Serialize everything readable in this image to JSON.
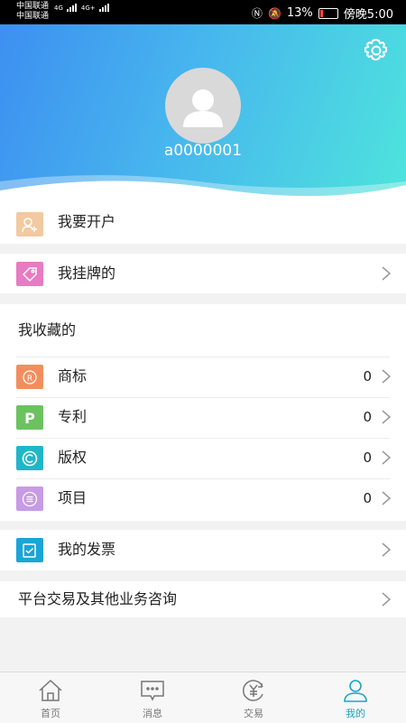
{
  "status_bar": {
    "carrier1": "中国联通",
    "carrier2": "中国联通",
    "net1": "4G",
    "net2": "4G+",
    "battery": "13%",
    "time": "傍晚5:00"
  },
  "profile": {
    "username": "a0000001",
    "settings_icon": "gear-icon",
    "avatar_icon": "person-icon"
  },
  "menu": {
    "open_account": "我要开户",
    "my_listings": "我挂牌的",
    "favorites_title": "我收藏的",
    "favorites": [
      {
        "label": "商标",
        "count": "0",
        "icon": "trademark-icon",
        "color": "#f28e5e"
      },
      {
        "label": "专利",
        "count": "0",
        "icon": "patent-icon",
        "color": "#6cc25f"
      },
      {
        "label": "版权",
        "count": "0",
        "icon": "copyright-icon",
        "color": "#1fb7c7"
      },
      {
        "label": "项目",
        "count": "0",
        "icon": "project-icon",
        "color": "#c79be5"
      }
    ],
    "invoice": "我的发票",
    "consult": "平台交易及其他业务咨询"
  },
  "tabs": [
    {
      "label": "首页",
      "icon": "home-icon"
    },
    {
      "label": "消息",
      "icon": "message-icon"
    },
    {
      "label": "交易",
      "icon": "yuan-icon"
    },
    {
      "label": "我的",
      "icon": "user-icon",
      "active": true
    }
  ],
  "colors": {
    "accent": "#1aa5c4",
    "header_start": "#3d8ff0",
    "header_end": "#4ee4dc"
  }
}
